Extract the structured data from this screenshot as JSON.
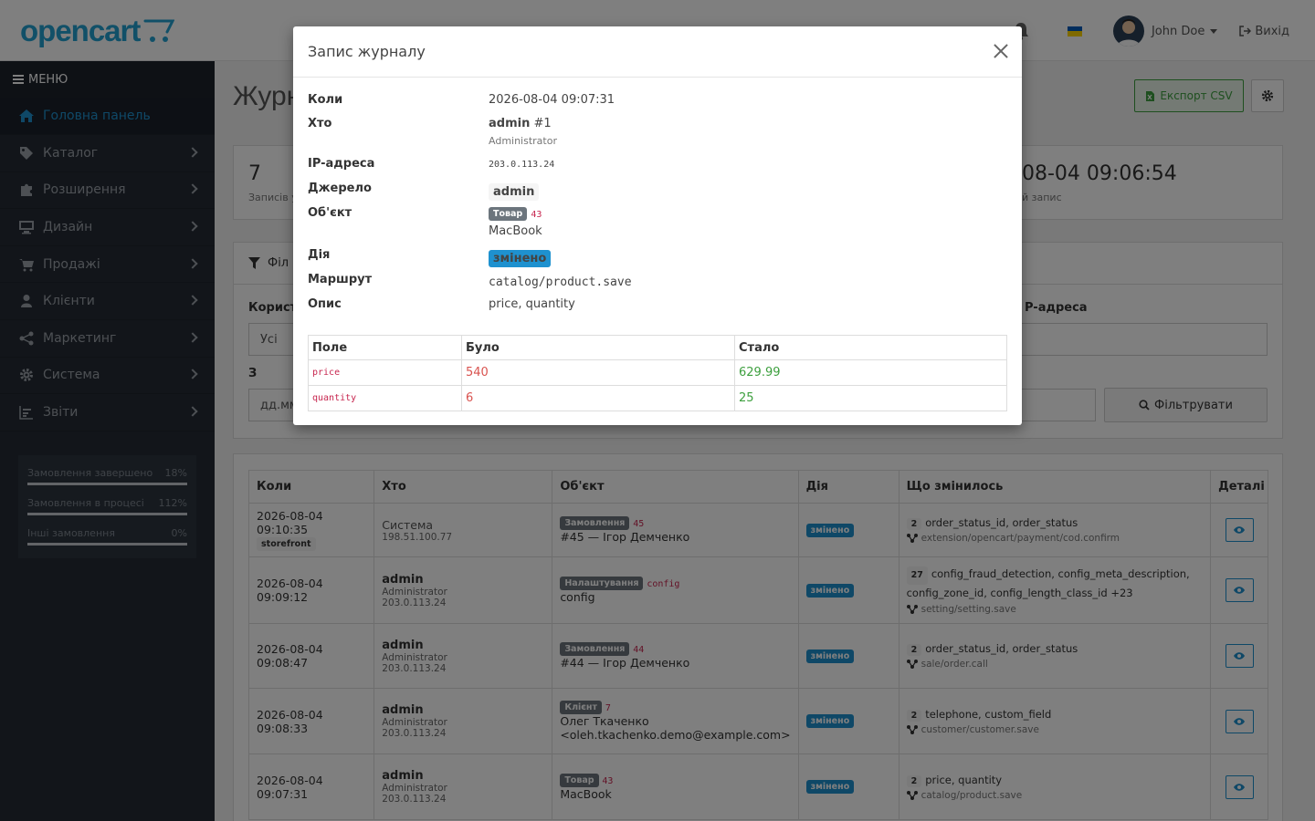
{
  "header": {
    "logo": "opencart",
    "user_name": "John Doe",
    "logout_label": "Вихід"
  },
  "sidebar": {
    "menu_label": "МЕНЮ",
    "items": [
      {
        "label": "Головна панель",
        "icon": "home-icon"
      },
      {
        "label": "Каталог",
        "icon": "tag-icon"
      },
      {
        "label": "Розширення",
        "icon": "puzzle-icon"
      },
      {
        "label": "Дизайн",
        "icon": "desktop-icon"
      },
      {
        "label": "Продажі",
        "icon": "cart-icon"
      },
      {
        "label": "Клієнти",
        "icon": "user-icon"
      },
      {
        "label": "Маркетинг",
        "icon": "share-icon"
      },
      {
        "label": "Система",
        "icon": "cog-icon"
      },
      {
        "label": "Звіти",
        "icon": "bar-chart-icon"
      }
    ],
    "stats": [
      {
        "label": "Замовлення завершено",
        "value": "18%",
        "fill": 0.18
      },
      {
        "label": "Замовлення в процесі",
        "value": "112%",
        "fill": 1.0
      },
      {
        "label": "Інші замовлення",
        "value": "0%",
        "fill": 0.0
      }
    ]
  },
  "page": {
    "title_partial": "Журн",
    "export_label": "Експорт CSV",
    "summary": {
      "count": "7",
      "count_label_partial": "Записів у",
      "last_value_partial": "08-04 09:06:54",
      "last_label_partial": "й запис"
    },
    "filter": {
      "heading_partial": "Філ",
      "user_label_partial": "Корист",
      "user_value": "Усі",
      "from_label": "З",
      "date_placeholder_partial": "дд.мм",
      "ip_label_partial": "P-адреса",
      "button_label": "Фільтрувати"
    }
  },
  "table": {
    "headers": [
      "Коли",
      "Хто",
      "Об'єкт",
      "Дія",
      "Що змінилось",
      "Деталі"
    ],
    "rows": [
      {
        "when": "2026-08-04 09:10:35",
        "when_tag": "storefront",
        "who": "Система",
        "who_role": "",
        "who_ip": "198.51.100.77",
        "obj_type": "Замовлення",
        "obj_id": "45",
        "obj_name": "#45 — Ігор Демченко",
        "action": "змінено",
        "count": "2",
        "fields": "order_status_id, order_status",
        "route": "extension/opencart/payment/cod.confirm"
      },
      {
        "when": "2026-08-04 09:09:12",
        "when_tag": "",
        "who": "admin",
        "who_role": "Administrator",
        "who_ip": "203.0.113.24",
        "obj_type": "Налаштування",
        "obj_id": "config",
        "obj_name": "config",
        "action": "змінено",
        "count": "27",
        "fields": "config_fraud_detection, config_meta_description, config_zone_id, config_length_class_id +23",
        "route": "setting/setting.save"
      },
      {
        "when": "2026-08-04 09:08:47",
        "when_tag": "",
        "who": "admin",
        "who_role": "Administrator",
        "who_ip": "203.0.113.24",
        "obj_type": "Замовлення",
        "obj_id": "44",
        "obj_name": "#44 — Ігор Демченко",
        "action": "змінено",
        "count": "2",
        "fields": "order_status_id, order_status",
        "route": "sale/order.call"
      },
      {
        "when": "2026-08-04 09:08:33",
        "when_tag": "",
        "who": "admin",
        "who_role": "Administrator",
        "who_ip": "203.0.113.24",
        "obj_type": "Клієнт",
        "obj_id": "7",
        "obj_name": "Олег Ткаченко <oleh.tkachenko.demo@example.com>",
        "action": "змінено",
        "count": "2",
        "fields": "telephone, custom_field",
        "route": "customer/customer.save"
      },
      {
        "when": "2026-08-04 09:07:31",
        "when_tag": "",
        "who": "admin",
        "who_role": "Administrator",
        "who_ip": "203.0.113.24",
        "obj_type": "Товар",
        "obj_id": "43",
        "obj_name": "MacBook",
        "action": "змінено",
        "count": "2",
        "fields": "price, quantity",
        "route": "catalog/product.save"
      }
    ]
  },
  "modal": {
    "title": "Запис журналу",
    "labels": {
      "when": "Коли",
      "who": "Хто",
      "ip": "IP-адреса",
      "source": "Джерело",
      "object": "Об'єкт",
      "action": "Дія",
      "route": "Маршрут",
      "description": "Опис"
    },
    "when": "2026-08-04 09:07:31",
    "who": "admin",
    "who_id": "#1",
    "who_role": "Administrator",
    "ip": "203.0.113.24",
    "source": "admin",
    "obj_type": "Товар",
    "obj_id": "43",
    "obj_name": "MacBook",
    "action": "змінено",
    "route": "catalog/product.save",
    "description": "price, quantity",
    "diff_headers": [
      "Поле",
      "Було",
      "Стало"
    ],
    "diff_rows": [
      {
        "field": "price",
        "old": "540",
        "new": "629.99"
      },
      {
        "field": "quantity",
        "old": "6",
        "new": "25"
      }
    ]
  },
  "colors": {
    "accent": "#1e91cf",
    "green": "#3d9f3e",
    "red": "#d9534f",
    "sidebar": "#242b35"
  }
}
